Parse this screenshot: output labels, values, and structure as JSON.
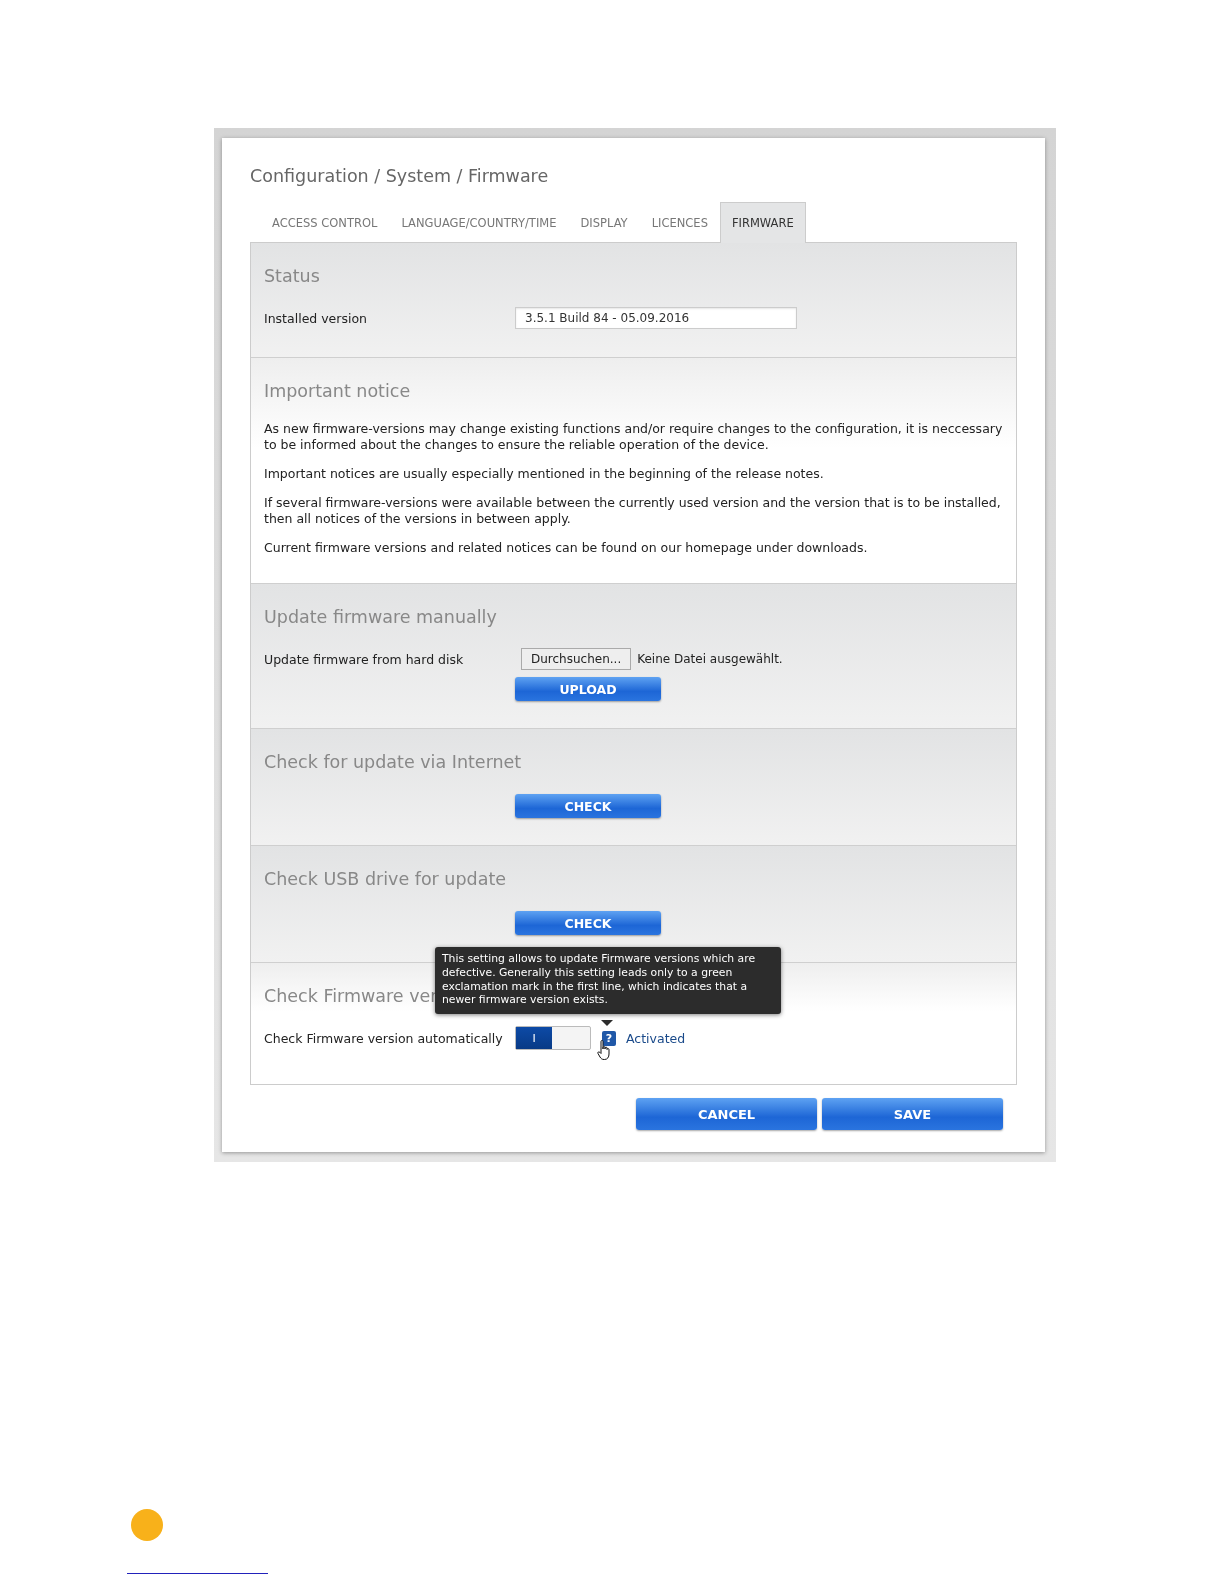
{
  "breadcrumb": "Configuration / System / Firmware",
  "tabs": [
    {
      "label": "ACCESS CONTROL",
      "selected": false
    },
    {
      "label": "LANGUAGE/COUNTRY/TIME",
      "selected": false
    },
    {
      "label": "DISPLAY",
      "selected": false
    },
    {
      "label": "LICENCES",
      "selected": false
    },
    {
      "label": "FIRMWARE",
      "selected": true
    }
  ],
  "sections": [
    {
      "kind": "status",
      "title": "Status",
      "label": "Installed version",
      "value": "3.5.1 Build 84 - 05.09.2016"
    },
    {
      "kind": "notice",
      "title": "Important notice",
      "paragraphs": [
        "As new firmware-versions may change existing functions and/or require changes to the configuration, it is neccessary to be informed about the changes to ensure the reliable operation of the device.",
        "Important notices are usually especially mentioned in the beginning of the release notes.",
        "If several firmware-versions were available between the currently used version and the version that is to be installed, then all notices of the versions in between apply.",
        "Current firmware versions and related notices can be found on our homepage under downloads."
      ]
    },
    {
      "kind": "upload",
      "title": "Update firmware manually",
      "label": "Update firmware from hard disk",
      "browse_button": "Durchsuchen...",
      "file_status": "Keine Datei ausgewählt.",
      "button": "UPLOAD"
    },
    {
      "kind": "action",
      "title": "Check for update via Internet",
      "button": "CHECK"
    },
    {
      "kind": "action",
      "title": "Check USB drive for update",
      "button": "CHECK"
    },
    {
      "kind": "toggle",
      "title": "Check Firmware ver",
      "label": "Check Firmware version automatically",
      "toggle": {
        "on": true,
        "text": "I"
      },
      "help": "?",
      "status": "Activated",
      "tooltip": "This setting allows to update Firmware versions which are defective. Generally this setting leads only to a green exclamation mark in the first line, which indicates that a newer firmware version exists."
    }
  ],
  "buttons": [
    "CANCEL",
    "SAVE"
  ]
}
